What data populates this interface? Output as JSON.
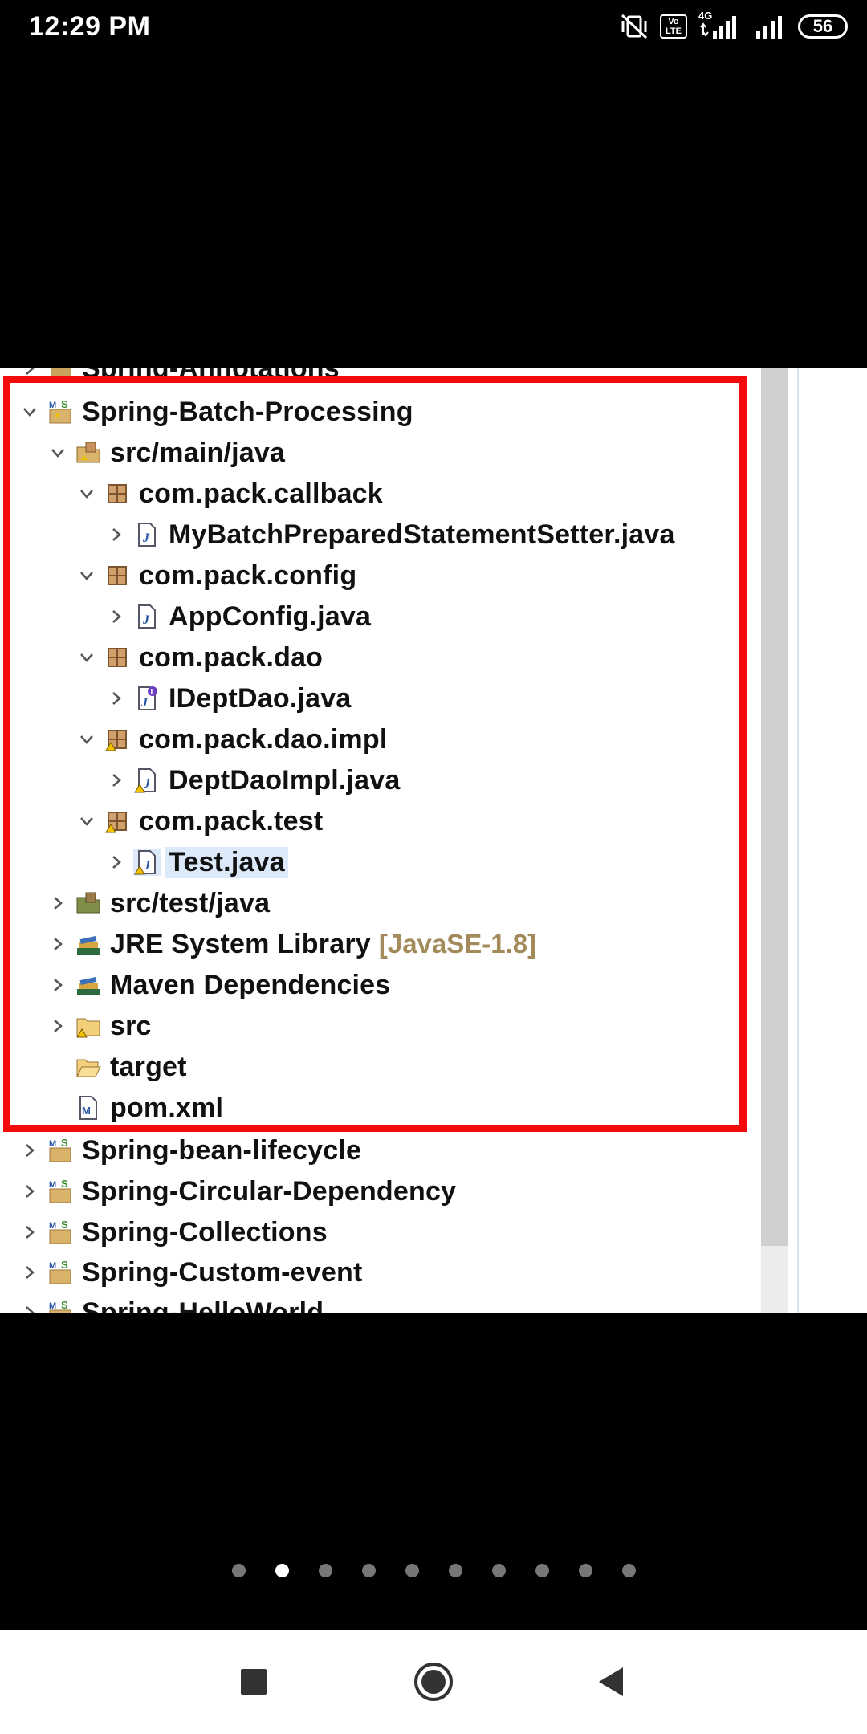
{
  "status_bar": {
    "time": "12:29 PM",
    "volte": "Vo\nLTE",
    "network": "4G",
    "battery": "56"
  },
  "tree": {
    "partial_top": "Spring-Annotations",
    "project": "Spring-Batch-Processing",
    "src_main": "src/main/java",
    "pkg_callback": "com.pack.callback",
    "file_setter": "MyBatchPreparedStatementSetter.java",
    "pkg_config": "com.pack.config",
    "file_appconfig": "AppConfig.java",
    "pkg_dao": "com.pack.dao",
    "file_ideptdao": "IDeptDao.java",
    "pkg_dao_impl": "com.pack.dao.impl",
    "file_deptdaoimpl": "DeptDaoImpl.java",
    "pkg_test": "com.pack.test",
    "file_test": "Test.java",
    "src_test": "src/test/java",
    "jre_label": "JRE System Library",
    "jre_version": "[JavaSE-1.8]",
    "maven_deps": "Maven Dependencies",
    "src": "src",
    "target": "target",
    "pom": "pom.xml",
    "proj_lifecycle": "Spring-bean-lifecycle",
    "proj_circular": "Spring-Circular-Dependency",
    "proj_collections": "Spring-Collections",
    "proj_custom_event": "Spring-Custom-event",
    "proj_helloworld": "Spring-HelloWorld"
  },
  "pager": {
    "count": 10,
    "active_index": 1
  },
  "colors": {
    "highlight_frame": "#f30a0a",
    "selection": "#dbe9f9"
  }
}
